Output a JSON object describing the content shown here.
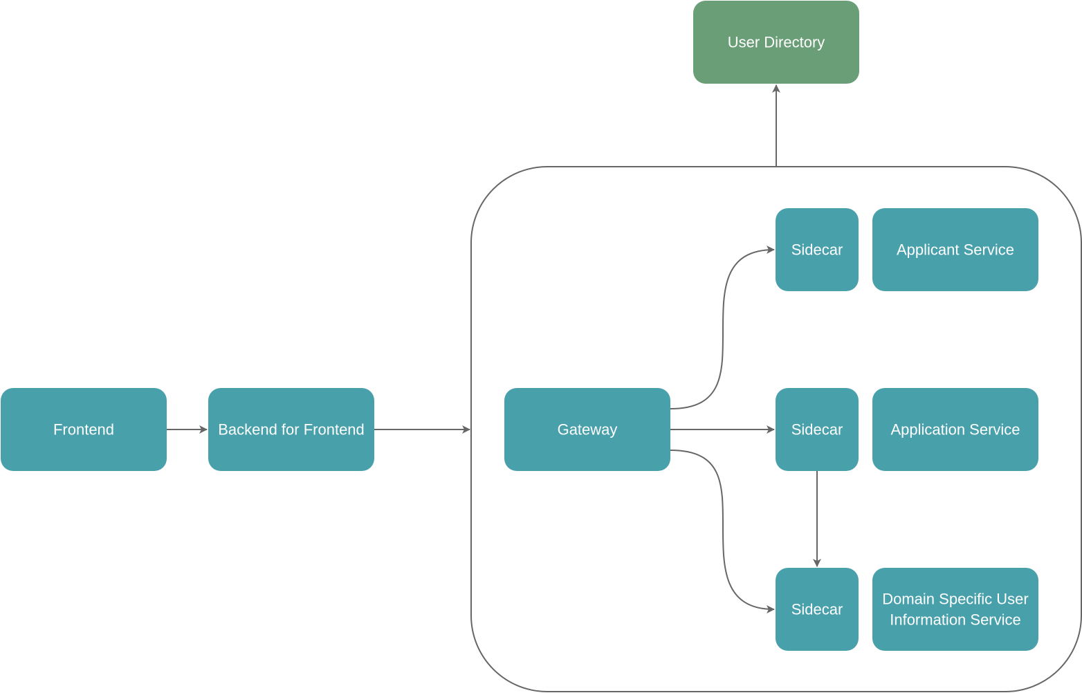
{
  "diagram": {
    "colors": {
      "service_fill": "#48A0AB",
      "external_fill": "#6A9E77",
      "edge_stroke": "#666666",
      "text": "#FFFFFF"
    },
    "nodes": {
      "user_directory": {
        "label": "User Directory"
      },
      "frontend": {
        "label": "Frontend"
      },
      "bff": {
        "label": "Backend for Frontend"
      },
      "gateway": {
        "label": "Gateway"
      },
      "sidecar_1": {
        "label": "Sidecar"
      },
      "sidecar_2": {
        "label": "Sidecar"
      },
      "sidecar_3": {
        "label": "Sidecar"
      },
      "applicant_service": {
        "label": "Applicant Service"
      },
      "application_service": {
        "label": "Application Service"
      },
      "dsuis": {
        "label_line1": "Domain Specific User",
        "label_line2": "Information Service"
      }
    },
    "edges": [
      {
        "from": "frontend",
        "to": "bff"
      },
      {
        "from": "bff",
        "to": "service-mesh-container"
      },
      {
        "from": "service-mesh-container",
        "to": "user_directory"
      },
      {
        "from": "gateway",
        "to": "sidecar_1"
      },
      {
        "from": "gateway",
        "to": "sidecar_2"
      },
      {
        "from": "gateway",
        "to": "sidecar_3"
      },
      {
        "from": "sidecar_2",
        "to": "sidecar_3"
      }
    ]
  }
}
